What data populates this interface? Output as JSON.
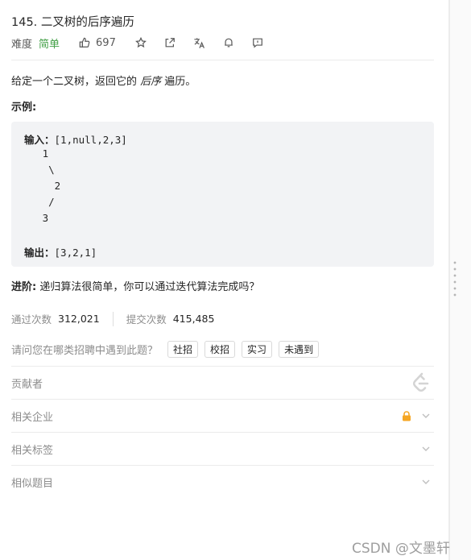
{
  "problem": {
    "title": "145. 二叉树的后序遍历",
    "difficulty_label": "难度",
    "difficulty": "简单",
    "likes": "697"
  },
  "description": {
    "before": "给定一个二叉树，返回它的 ",
    "emphasis": "后序",
    "after": " 遍历。"
  },
  "example": {
    "title": "示例:",
    "input_label": "输入：",
    "input_value": "[1,null,2,3]",
    "tree_lines": [
      "   1",
      "    \\",
      "     2",
      "    /",
      "   3"
    ],
    "output_label": "输出：",
    "output_value": "[3,2,1]"
  },
  "advanced": {
    "label": "进阶:",
    "text": " 递归算法很简单，你可以通过迭代算法完成吗？"
  },
  "stats": {
    "accepted_label": "通过次数",
    "accepted_value": "312,021",
    "submitted_label": "提交次数",
    "submitted_value": "415,485"
  },
  "interview": {
    "question": "请问您在哪类招聘中遇到此题？",
    "tags": [
      "社招",
      "校招",
      "实习",
      "未遇到"
    ]
  },
  "sections": {
    "contributors": "贡献者",
    "companies": "相关企业",
    "tags": "相关标签",
    "similar": "相似题目"
  },
  "watermark": "CSDN @文墨轩",
  "colors": {
    "difficulty_easy": "#43a047",
    "lock": "#f5a623"
  },
  "icons": [
    "thumb-up-icon",
    "star-icon",
    "share-icon",
    "translate-icon",
    "bell-icon",
    "comment-icon",
    "leetcode-logo-icon",
    "lock-icon",
    "chevron-down-icon"
  ]
}
